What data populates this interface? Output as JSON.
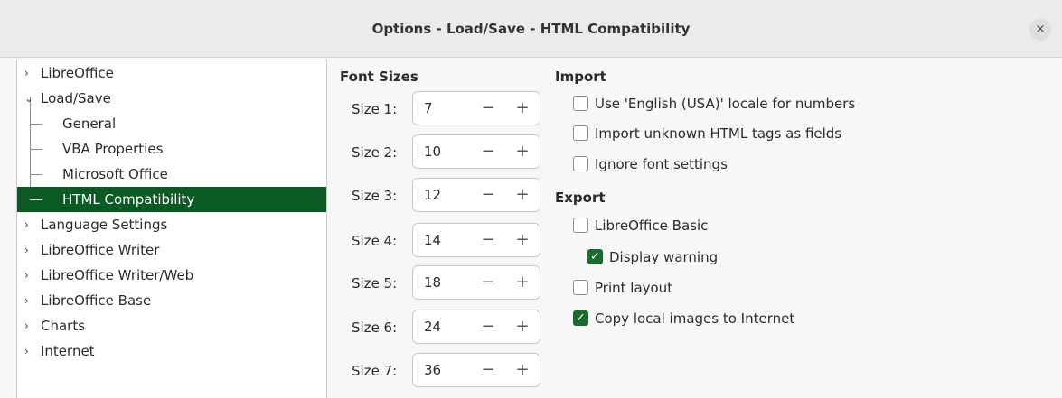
{
  "window": {
    "title": "Options - Load/Save - HTML Compatibility",
    "close_glyph": "×"
  },
  "tree": {
    "items": [
      {
        "label": "LibreOffice",
        "arrow": "›"
      },
      {
        "label": "Load/Save",
        "arrow": "⌄"
      },
      {
        "label": "General"
      },
      {
        "label": "VBA Properties"
      },
      {
        "label": "Microsoft Office"
      },
      {
        "label": "HTML Compatibility",
        "selected": true
      },
      {
        "label": "Language Settings",
        "arrow": "›"
      },
      {
        "label": "LibreOffice Writer",
        "arrow": "›"
      },
      {
        "label": "LibreOffice Writer/Web",
        "arrow": "›"
      },
      {
        "label": "LibreOffice Base",
        "arrow": "›"
      },
      {
        "label": "Charts",
        "arrow": "›"
      },
      {
        "label": "Internet",
        "arrow": "›"
      }
    ]
  },
  "font_sizes": {
    "title": "Font Sizes",
    "rows": [
      {
        "label": "Size 1:",
        "value": "7"
      },
      {
        "label": "Size 2:",
        "value": "10"
      },
      {
        "label": "Size 3:",
        "value": "12"
      },
      {
        "label": "Size 4:",
        "value": "14"
      },
      {
        "label": "Size 5:",
        "value": "18"
      },
      {
        "label": "Size 6:",
        "value": "24"
      },
      {
        "label": "Size 7:",
        "value": "36"
      }
    ],
    "minus_glyph": "−",
    "plus_glyph": "+"
  },
  "import": {
    "title": "Import",
    "options": [
      {
        "label": "Use 'English (USA)' locale for numbers",
        "checked": false
      },
      {
        "label": "Import unknown HTML tags as fields",
        "checked": false
      },
      {
        "label": "Ignore font settings",
        "checked": false
      }
    ]
  },
  "export": {
    "title": "Export",
    "options": [
      {
        "label": "LibreOffice Basic",
        "checked": false
      },
      {
        "label": "Display warning",
        "checked": true
      },
      {
        "label": "Print layout",
        "checked": false
      },
      {
        "label": "Copy local images to Internet",
        "checked": true
      }
    ]
  },
  "colors": {
    "selection": "#0c5a23",
    "checkbox_checked": "#1c6a2f"
  },
  "check_glyph": "✓"
}
